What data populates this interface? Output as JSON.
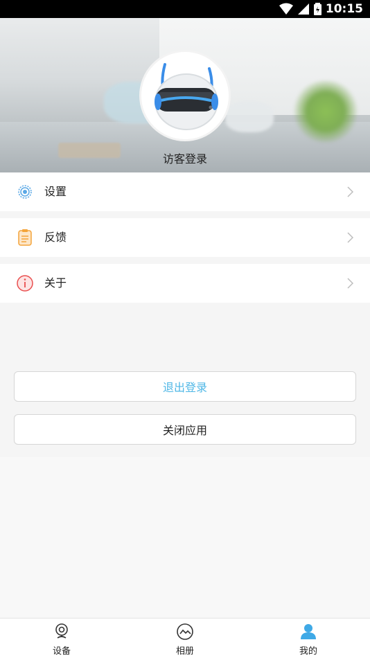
{
  "status_bar": {
    "time": "10:15"
  },
  "profile": {
    "name": "访客登录"
  },
  "menu": {
    "items": [
      {
        "label": "设置",
        "icon": "settings-gear-icon"
      },
      {
        "label": "反馈",
        "icon": "feedback-document-icon"
      },
      {
        "label": "关于",
        "icon": "about-info-icon"
      }
    ]
  },
  "buttons": {
    "logout": "退出登录",
    "close_app": "关闭应用"
  },
  "tabbar": {
    "tabs": [
      {
        "label": "设备",
        "icon": "camera-device-icon"
      },
      {
        "label": "相册",
        "icon": "album-icon"
      },
      {
        "label": "我的",
        "icon": "profile-person-icon",
        "active": true
      }
    ]
  },
  "colors": {
    "accent": "#4fb7e6",
    "about_red": "#e94e4e",
    "feedback_orange": "#f4a43a"
  }
}
